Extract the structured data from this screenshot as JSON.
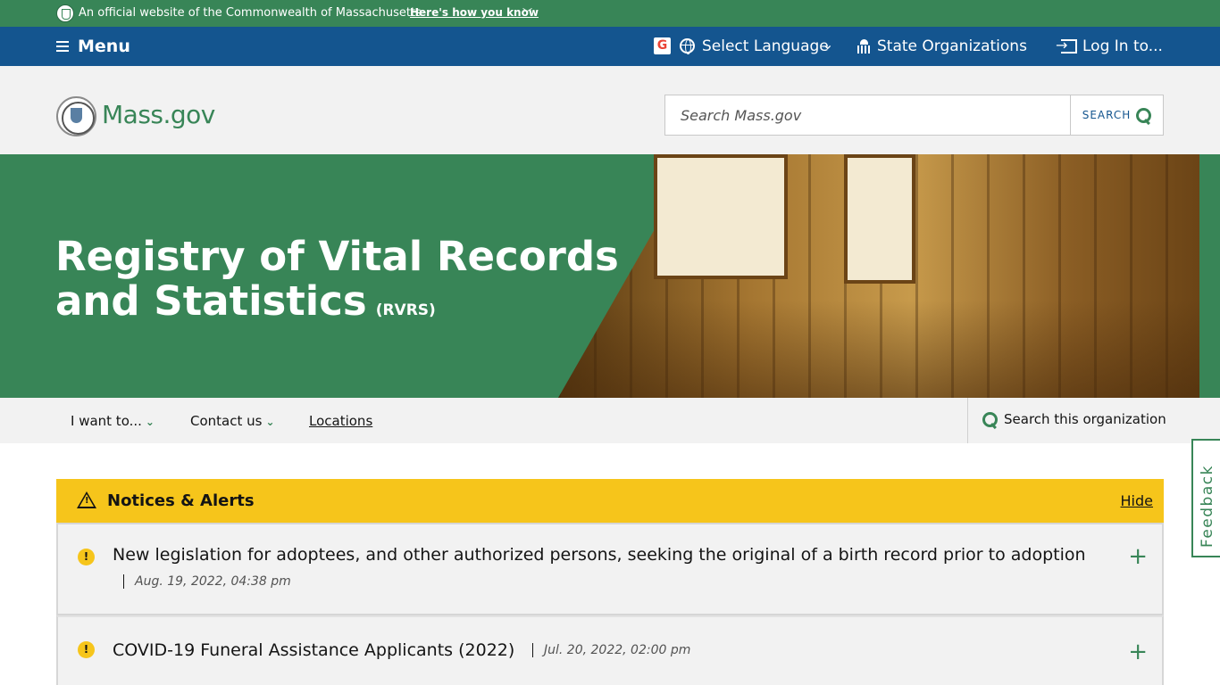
{
  "official_banner": {
    "text": "An official website of the Commonwealth of Massachusetts",
    "link": "Here's how you know",
    "link_icon": "chevron-down-icon"
  },
  "utility_nav": {
    "menu": "Menu",
    "select_language": "Select Language",
    "state_orgs": "State Organizations",
    "login": "Log In to..."
  },
  "header": {
    "logo_text": "Mass.gov",
    "search_placeholder": "Search Mass.gov",
    "search_button": "SEARCH"
  },
  "hero": {
    "title": "Registry of Vital Records and Statistics",
    "abbreviation": "(RVRS)"
  },
  "org_nav": {
    "i_want_to": "I want to...",
    "contact_us": "Contact us",
    "locations": "Locations",
    "search_org": "Search this organization"
  },
  "alerts": {
    "title": "Notices & Alerts",
    "hide": "Hide",
    "items": [
      {
        "title": "New legislation for adoptees, and other authorized persons, seeking the original of a birth record prior to adoption",
        "date": "Aug. 19, 2022, 04:38 pm"
      },
      {
        "title": "COVID-19 Funeral Assistance Applicants (2022)",
        "date": "Jul. 20, 2022, 02:00 pm"
      }
    ]
  },
  "feedback": "Feedback",
  "colors": {
    "green": "#388557",
    "blue": "#14558f",
    "yellow": "#f6c51b",
    "gray": "#f2f2f2"
  }
}
